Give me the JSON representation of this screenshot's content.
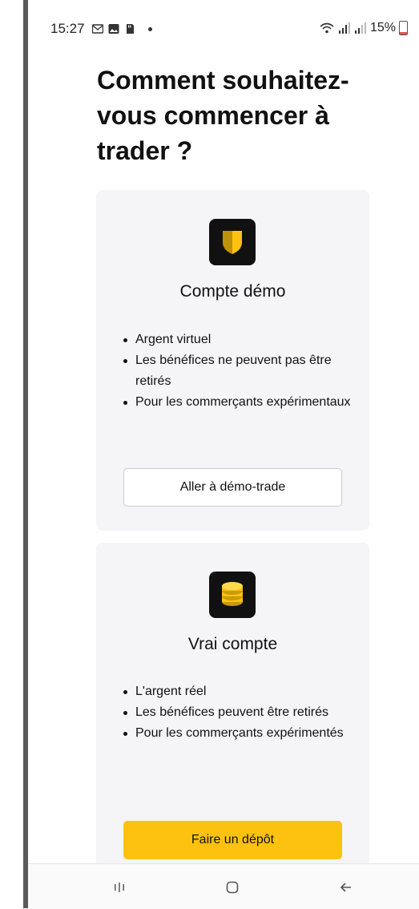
{
  "status_bar": {
    "time": "15:27",
    "battery": "15%",
    "icons": [
      "gmail-icon",
      "photo-icon",
      "sd-card-icon",
      "dot-icon",
      "wifi-icon",
      "signal-icon",
      "signal-icon",
      "battery-icon"
    ]
  },
  "page": {
    "title": "Comment souhaitez-vous commencer à trader ?"
  },
  "cards": {
    "demo": {
      "icon": "shield-icon",
      "title": "Compte démo",
      "features": [
        "Argent virtuel",
        "Les bénéfices ne peuvent pas être retirés",
        "Pour les commerçants expérimentaux"
      ],
      "button": "Aller à démo-trade"
    },
    "real": {
      "icon": "coins-icon",
      "title": "Vrai compte",
      "features": [
        "L'argent réel",
        "Les bénéfices peuvent être retirés",
        "Pour les commerçants expérimentés"
      ],
      "button": "Faire un dépôt"
    }
  },
  "colors": {
    "accent": "#fcc20f",
    "card_background": "#f5f5f7",
    "icon_background": "#111111"
  },
  "nav_bar": {
    "icons": [
      "recent-apps-icon",
      "home-icon",
      "back-icon"
    ]
  }
}
